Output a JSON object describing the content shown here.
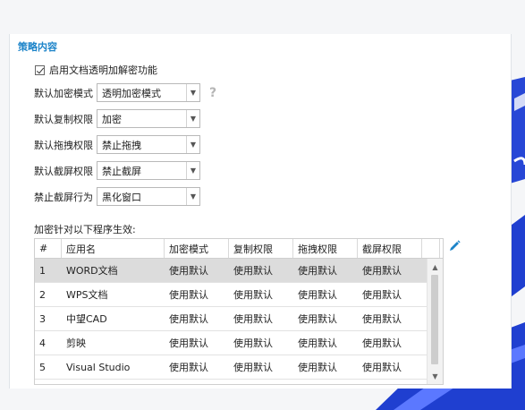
{
  "section": {
    "title": "策略内容"
  },
  "enable_checkbox": {
    "label": "启用文档透明加解密功能",
    "checked": true
  },
  "fields": [
    {
      "label": "默认加密模式",
      "value": "透明加密模式"
    },
    {
      "label": "默认复制权限",
      "value": "加密"
    },
    {
      "label": "默认拖拽权限",
      "value": "禁止拖拽"
    },
    {
      "label": "默认截屏权限",
      "value": "禁止截屏"
    },
    {
      "label": "禁止截屏行为",
      "value": "黑化窗口"
    }
  ],
  "help_icon": {
    "glyph": "?"
  },
  "list_caption": "加密针对以下程序生效:",
  "table": {
    "headers": [
      "#",
      "应用名",
      "加密模式",
      "复制权限",
      "拖拽权限",
      "截屏权限"
    ],
    "rows": [
      [
        "1",
        "WORD文档",
        "使用默认",
        "使用默认",
        "使用默认",
        "使用默认"
      ],
      [
        "2",
        "WPS文档",
        "使用默认",
        "使用默认",
        "使用默认",
        "使用默认"
      ],
      [
        "3",
        "中望CAD",
        "使用默认",
        "使用默认",
        "使用默认",
        "使用默认"
      ],
      [
        "4",
        "剪映",
        "使用默认",
        "使用默认",
        "使用默认",
        "使用默认"
      ],
      [
        "5",
        "Visual Studio",
        "使用默认",
        "使用默认",
        "使用默认",
        "使用默认"
      ]
    ],
    "selected_row": 0
  },
  "icons": {
    "edit": "pencil-icon",
    "help": "question-icon",
    "dropdown": "chevron-down-icon"
  },
  "colors": {
    "accent": "#1d84c9",
    "deco": "#1f3fd0"
  }
}
